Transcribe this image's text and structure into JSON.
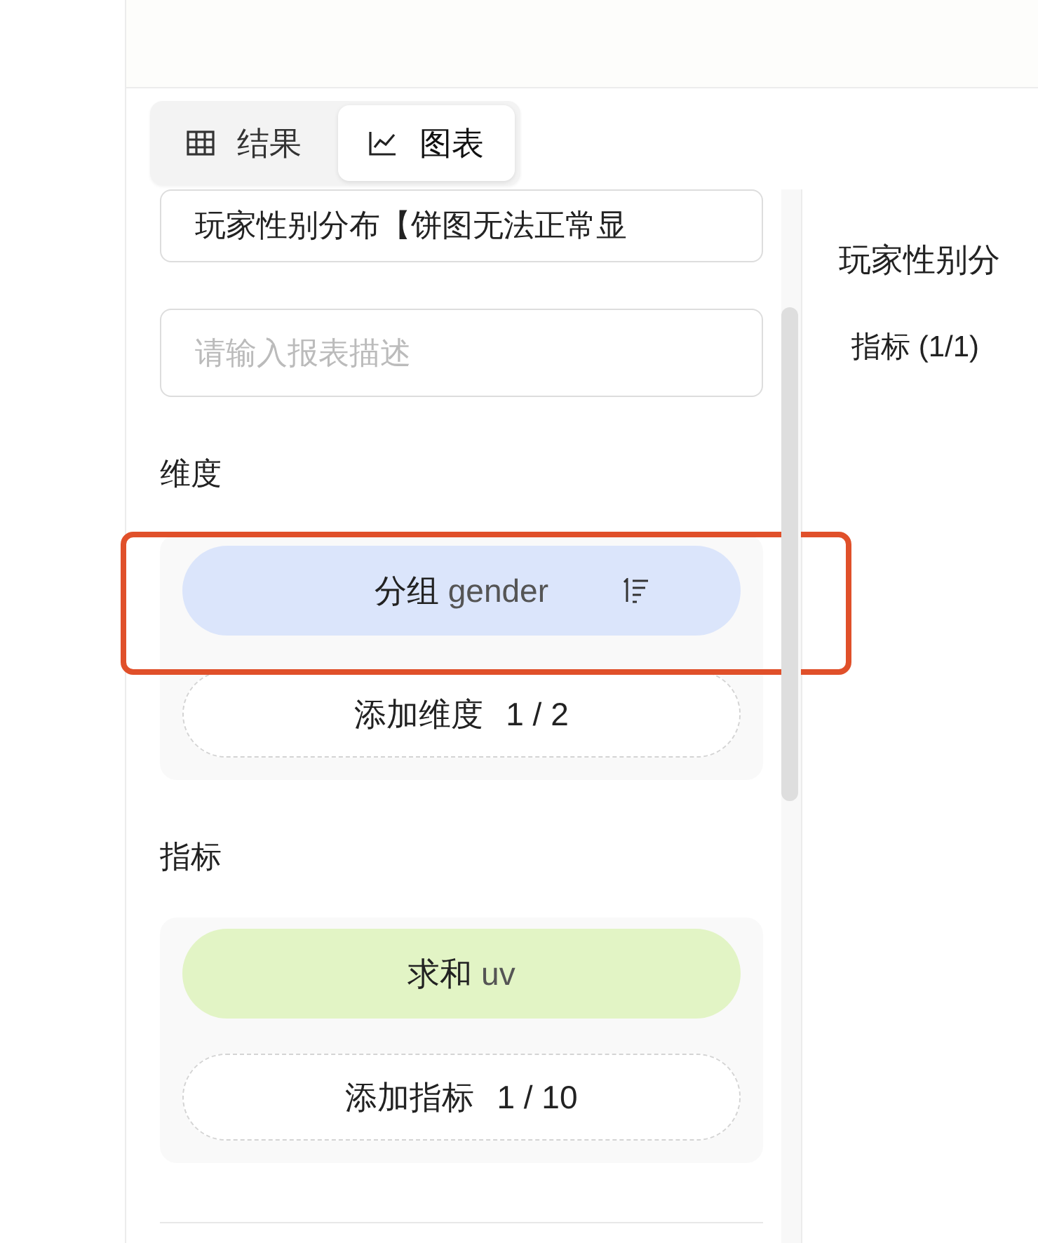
{
  "view_tabs": [
    {
      "label": "结果",
      "selected": false
    },
    {
      "label": "图表",
      "selected": true
    }
  ],
  "report_title": {
    "value": "玩家性别分布【饼图无法正常显"
  },
  "report_description": {
    "placeholder": "请输入报表描述"
  },
  "sections": [
    {
      "heading": "维度",
      "items": [
        {
          "kind": "dimension",
          "prefix": "分组",
          "field": "gender",
          "sortable": true,
          "highlighted": true
        }
      ],
      "add_button": {
        "label": "添加维度",
        "count": "1 / 2"
      }
    },
    {
      "heading": "指标",
      "items": [
        {
          "kind": "metric",
          "prefix": "求和",
          "field": "uv",
          "sortable": false,
          "highlighted": false
        }
      ],
      "add_button": {
        "label": "添加指标",
        "count": "1 / 10"
      }
    }
  ],
  "preview": {
    "title": "玩家性别分",
    "metric_summary": "指标 (1/1)"
  }
}
